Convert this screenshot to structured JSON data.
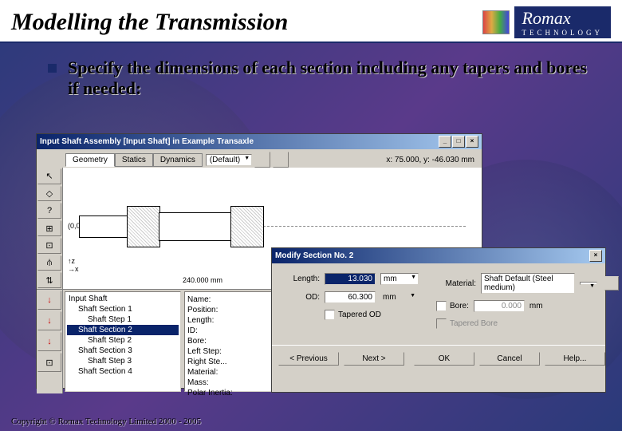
{
  "slide": {
    "title": "Modelling the Transmission",
    "bullet": "Specify the dimensions of each section including any tapers and bores if needed:",
    "copyright": "Copyright © Romax Technology Limited 2000 - 2005"
  },
  "logo": {
    "name": "Romax",
    "sub": "TECHNOLOGY"
  },
  "appwin": {
    "title": "Input Shaft Assembly [Input Shaft] in Example Transaxle",
    "tabs": [
      "Geometry",
      "Statics",
      "Dynamics"
    ],
    "active_tab": 0,
    "view_select": "(Default)",
    "coord": "x: 75.000, y: -46.030 mm",
    "tools": [
      "↖",
      "◇",
      "?",
      "⊞",
      "⊡",
      "⫛",
      "⇅"
    ],
    "origin_label": "(0,0)",
    "dim_label": "240.000 mm"
  },
  "tree": {
    "root": "Input Shaft",
    "items": [
      {
        "label": "Shaft Section 1",
        "level": 1
      },
      {
        "label": "Shaft Step 1",
        "level": 2
      },
      {
        "label": "Shaft Section 2",
        "level": 1,
        "sel": true
      },
      {
        "label": "Shaft Step 2",
        "level": 2
      },
      {
        "label": "Shaft Section 3",
        "level": 1
      },
      {
        "label": "Shaft Step 3",
        "level": 2
      },
      {
        "label": "Shaft Section 4",
        "level": 1
      }
    ]
  },
  "props": {
    "labels": [
      "Name:",
      "Position:",
      "Length:",
      "ID:",
      "Bore:",
      "Left Step:",
      "Right Ste...",
      "Material:",
      "Mass:",
      "Polar Inertia:"
    ]
  },
  "dialog": {
    "title": "Modify Section No. 2",
    "length_label": "Length:",
    "length_value": "13.030",
    "length_unit": "mm",
    "od_label": "OD:",
    "od_value": "60.300",
    "od_unit": "mm",
    "tapered_od": "Tapered OD",
    "material_label": "Material:",
    "material_value": "Shaft Default (Steel medium)",
    "bore_checkbox": "Bore:",
    "bore_value": "0.000",
    "bore_unit": "mm",
    "tapered_bore": "Tapered Bore",
    "buttons": {
      "prev": "< Previous",
      "next": "Next >",
      "ok": "OK",
      "cancel": "Cancel",
      "help": "Help..."
    }
  },
  "redtools": [
    "↓",
    "↓",
    "↓",
    "⊡"
  ]
}
